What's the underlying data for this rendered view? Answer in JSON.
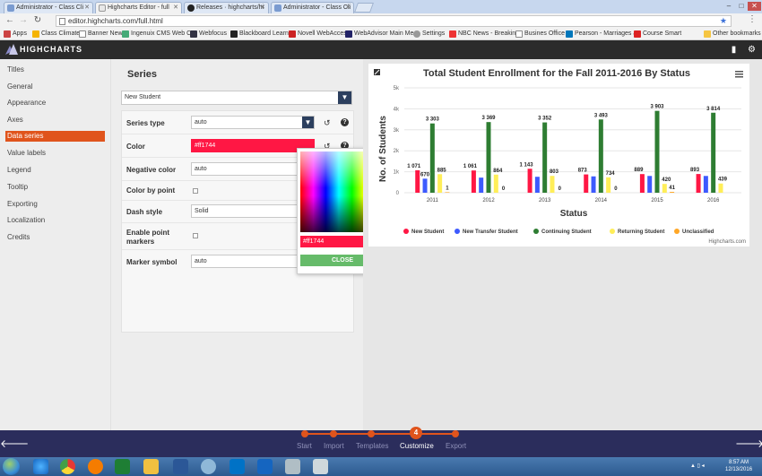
{
  "browser": {
    "tabs": [
      {
        "title": "Administrator - Class Cli",
        "active": false
      },
      {
        "title": "Highcharts Editor - full",
        "active": true
      },
      {
        "title": "Releases · highcharts/hi",
        "active": false
      },
      {
        "title": "Administrator - Class Cli",
        "active": false
      }
    ],
    "url": "editor.highcharts.com/full.html",
    "bookmarks": [
      "Apps",
      "Class Climate",
      "Banner New",
      "Ingenuix CMS Web C",
      "Webfocus",
      "Blackboard Learn",
      "Novell WebAccess",
      "WebAdvisor Main Me",
      "Settings",
      "NBC News - Breaking",
      "Busines Office",
      "Pearson - Marriages a",
      "Course Smart",
      "Other bookmarks"
    ]
  },
  "header": {
    "brand": "HIGHCHARTS"
  },
  "sidenav": {
    "items": [
      "Titles",
      "General",
      "Appearance",
      "Axes",
      "Data series",
      "Value labels",
      "Legend",
      "Tooltip",
      "Exporting",
      "Localization",
      "Credits"
    ],
    "active": "Data series"
  },
  "series_panel": {
    "title": "Series",
    "selected_series": "New Student",
    "fields": {
      "series_type": {
        "label": "Series type",
        "value": "auto"
      },
      "color": {
        "label": "Color",
        "value": "#ff1744"
      },
      "negative_color": {
        "label": "Negative color",
        "value": "auto"
      },
      "color_by_point": {
        "label": "Color by point"
      },
      "dash_style": {
        "label": "Dash style",
        "value": "Solid"
      },
      "enable_point_markers": {
        "label": "Enable point markers"
      },
      "marker_symbol": {
        "label": "Marker symbol",
        "value": "auto"
      }
    }
  },
  "color_picker": {
    "value": "#ff1744",
    "close_label": "CLOSE"
  },
  "chart_data": {
    "type": "bar",
    "title": "Total Student Enrollment for the Fall 2011-2016 By Status",
    "xlabel": "Status",
    "ylabel": "No. of Students",
    "categories": [
      "2011",
      "2012",
      "2013",
      "2014",
      "2015",
      "2016"
    ],
    "ylim": [
      0,
      5000
    ],
    "yticks": [
      "0",
      "1k",
      "2k",
      "3k",
      "4k",
      "5k"
    ],
    "series": [
      {
        "name": "New Student",
        "color": "#ff1744",
        "values": [
          1071,
          1061,
          1143,
          873,
          889,
          893
        ],
        "labels": [
          "1 071",
          "1 061",
          "1 143",
          "873",
          "889",
          "893"
        ]
      },
      {
        "name": "New Transfer Student",
        "color": "#3d5afe",
        "values": [
          670,
          720,
          760,
          780,
          800,
          800
        ],
        "labels": [
          "670",
          "",
          "",
          "",
          "",
          ""
        ]
      },
      {
        "name": "Continuing Student",
        "color": "#2e7d32",
        "values": [
          3303,
          3369,
          3352,
          3493,
          3903,
          3814
        ],
        "labels": [
          "3 303",
          "3 369",
          "3 352",
          "3 493",
          "3 903",
          "3 814"
        ]
      },
      {
        "name": "Returning Student",
        "color": "#ffee58",
        "values": [
          885,
          864,
          803,
          734,
          420,
          439
        ],
        "labels": [
          "885",
          "864",
          "803",
          "734",
          "420",
          "439"
        ]
      },
      {
        "name": "Unclassified",
        "color": "#ffa726",
        "values": [
          1,
          0,
          0,
          0,
          41,
          0
        ],
        "labels": [
          "1",
          "0",
          "0",
          "0",
          "41",
          ""
        ]
      }
    ],
    "legend": "bottom",
    "credits": "Highcharts.com"
  },
  "stepper": {
    "steps": [
      "Start",
      "Import",
      "Templates",
      "Customize",
      "Export"
    ],
    "active_index": 3,
    "active_number": "4"
  },
  "taskbar": {
    "time": "8:57 AM",
    "date": "12/13/2016"
  }
}
